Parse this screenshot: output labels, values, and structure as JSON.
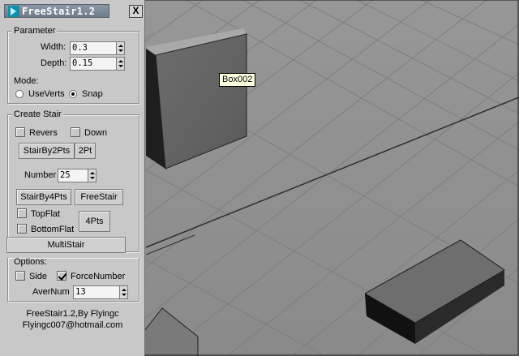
{
  "window": {
    "title": "FreeStair1.2",
    "close_label": "X"
  },
  "viewport": {
    "tooltip": "Box002"
  },
  "parameter": {
    "legend": "Parameter",
    "width_label": "Width:",
    "width_value": "0.3",
    "depth_label": "Depth:",
    "depth_value": "0.15",
    "mode_label": "Mode:",
    "mode_options": [
      "UseVerts",
      "Snap"
    ],
    "mode_selected": "Snap"
  },
  "create_stair": {
    "legend": "Create Stair",
    "revers_label": "Revers",
    "revers_checked": false,
    "down_label": "Down",
    "down_checked": false,
    "stairby2pts_label": "StairBy2Pts",
    "twopt_label": "2Pt",
    "number_label": "Number",
    "number_value": "25",
    "stairby4pts_label": "StairBy4Pts",
    "freestair_label": "FreeStair",
    "topflat_label": "TopFlat",
    "topflat_checked": false,
    "bottomflat_label": "BottomFlat",
    "bottomflat_checked": false,
    "fourpts_label": "4Pts",
    "multistair_label": "MultiStair"
  },
  "options": {
    "legend": "Options:",
    "side_label": "Side",
    "side_checked": false,
    "forcenumber_label": "ForceNumber",
    "forcenumber_checked": true,
    "avernum_label": "AverNum",
    "avernum_value": "13"
  },
  "footer": {
    "line1": "FreeStair1.2,By Flyingc",
    "line2": "Flyingc007@hotmail.com"
  },
  "icons": [
    "app-icon",
    "close-icon",
    "spinner-up-icon",
    "spinner-down-icon",
    "mouse-cursor-icon"
  ],
  "colors": {
    "panel_bg": "#c8c8c8",
    "title_bar": "#6f7b8b",
    "viewport_floor": "#8e8e8e",
    "tooltip_bg": "#ffffe1"
  }
}
